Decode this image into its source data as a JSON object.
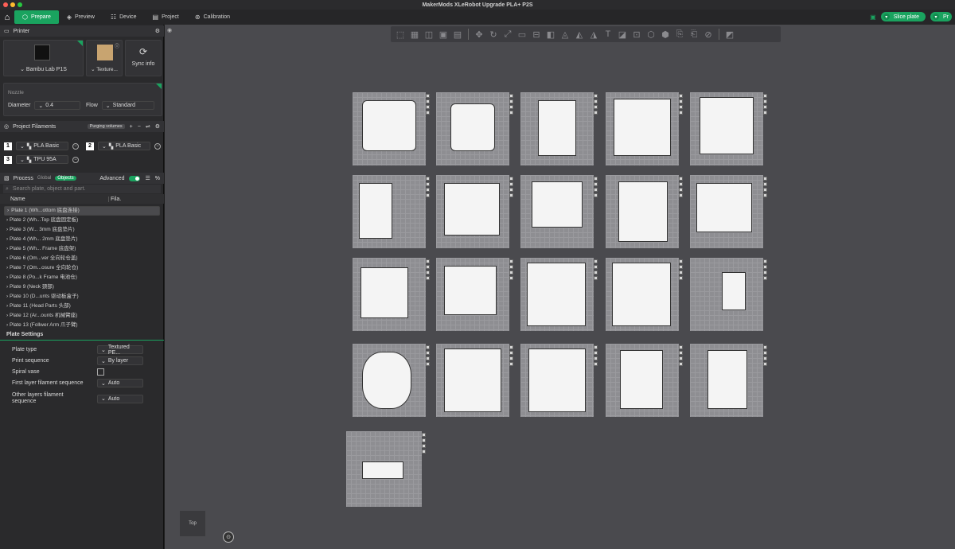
{
  "window": {
    "title": "MakerMods XLeRobot Upgrade PLA+ P2S"
  },
  "tabs": [
    {
      "label": "Prepare",
      "icon": "cube-plus-icon"
    },
    {
      "label": "Preview",
      "icon": "layers-icon"
    },
    {
      "label": "Device",
      "icon": "sliders-icon"
    },
    {
      "label": "Project",
      "icon": "document-icon"
    },
    {
      "label": "Calibration",
      "icon": "calibration-icon"
    }
  ],
  "actions": {
    "slice": "Slice plate",
    "print": "Pr"
  },
  "printer": {
    "header": "Printer",
    "name": "Bambu Lab P1S",
    "plate_type_short": "Texture...",
    "sync": "Sync info",
    "nozzle_label": "Nozzle",
    "diameter_label": "Diameter",
    "diameter": "0.4",
    "flow_label": "Flow",
    "flow": "Standard"
  },
  "filaments": {
    "header": "Project Filaments",
    "purging": "Purging volumes",
    "items": [
      {
        "num": "1",
        "name": "PLA Basic"
      },
      {
        "num": "2",
        "name": "PLA Basic"
      },
      {
        "num": "3",
        "name": "TPU 95A"
      }
    ]
  },
  "process": {
    "header": "Process",
    "global": "Global",
    "objects": "Objects",
    "advanced": "Advanced",
    "advanced_on": true,
    "search_placeholder": "Search plate, object and part.",
    "col_name": "Name",
    "col_fila": "Fila.",
    "plates": [
      "Plate 1 (Wh...ottom 底盘连接)",
      "Plate 2 (Wh...Top 底盘固定板)",
      "Plate 3 (W... 3mm 底盘垫片)",
      "Plate 4 (Wh... 2mm 底盘垫片)",
      "Plate 5 (Wh... Frame 底盘架)",
      "Plate 6 (Om...ver 全向轮仓盖)",
      "Plate 7 (Om...osure 全向轮仓)",
      "Plate 8 (Po...k Frame 电池仓)",
      "Plate 9 (Neck 颈部)",
      "Plate 10 (D...unts 驱动板盒子)",
      "Plate 11 (Head Parts 头部)",
      "Plate 12 (Ar...ounts 机械臂座)",
      "Plate 13 (Follwer Arm 爪子臂)"
    ]
  },
  "plate_settings": {
    "header": "Plate Settings",
    "rows": [
      {
        "label": "Plate type",
        "value": "Textured PE..."
      },
      {
        "label": "Print sequence",
        "value": "By layer"
      },
      {
        "label": "Spiral vase",
        "value": ""
      },
      {
        "label": "First layer filament sequence",
        "value": "Auto"
      },
      {
        "label": "Other layers filament sequence",
        "value": "Auto"
      }
    ]
  },
  "viewport": {
    "view_label": "Top"
  },
  "colors": {
    "accent": "#1aa35f",
    "bed": "#8e8e92",
    "canvas": "#4a4a4e"
  }
}
